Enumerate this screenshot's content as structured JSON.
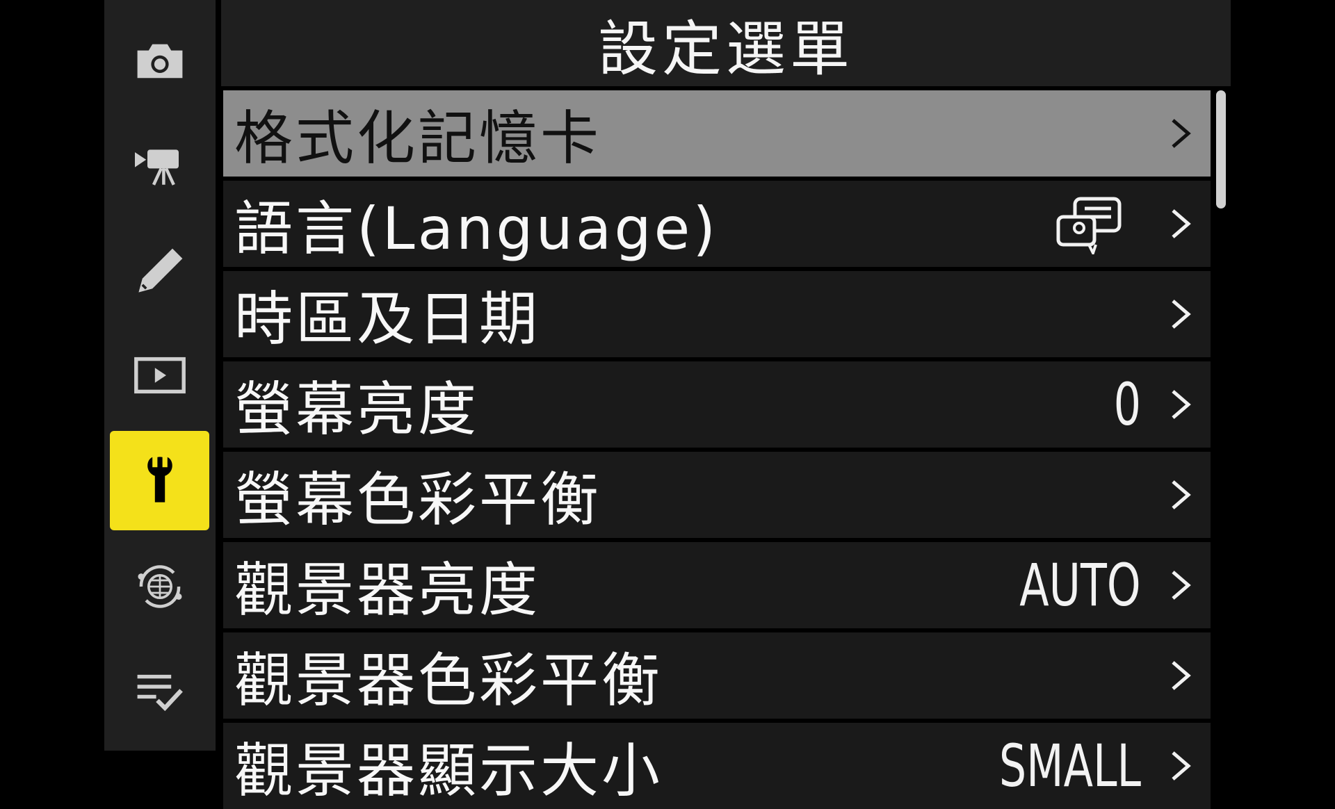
{
  "header": {
    "title": "設定選單"
  },
  "sidebar": {
    "items": [
      {
        "icon": "camera-icon",
        "active": false
      },
      {
        "icon": "movie-camera-icon",
        "active": false
      },
      {
        "icon": "pencil-icon",
        "active": false
      },
      {
        "icon": "playback-icon",
        "active": false
      },
      {
        "icon": "wrench-icon",
        "active": true
      },
      {
        "icon": "network-globe-icon",
        "active": false
      },
      {
        "icon": "my-menu-checklist-icon",
        "active": false
      }
    ]
  },
  "menu": {
    "items": [
      {
        "label": "格式化記憶卡",
        "value": "",
        "selected": true
      },
      {
        "label": "語言(Language)",
        "value": "",
        "icon": "language-icon",
        "selected": false
      },
      {
        "label": "時區及日期",
        "value": "",
        "selected": false
      },
      {
        "label": "螢幕亮度",
        "value": "0",
        "selected": false
      },
      {
        "label": "螢幕色彩平衡",
        "value": "",
        "selected": false
      },
      {
        "label": "觀景器亮度",
        "value": "AUTO",
        "selected": false
      },
      {
        "label": "觀景器色彩平衡",
        "value": "",
        "selected": false
      },
      {
        "label": "觀景器顯示大小",
        "value": "SMALL",
        "selected": false
      }
    ]
  },
  "colors": {
    "accent": "#f4e11a",
    "selected_row": "#8d8d8d",
    "row": "#1a1a1a",
    "header": "#1f1f1f"
  }
}
